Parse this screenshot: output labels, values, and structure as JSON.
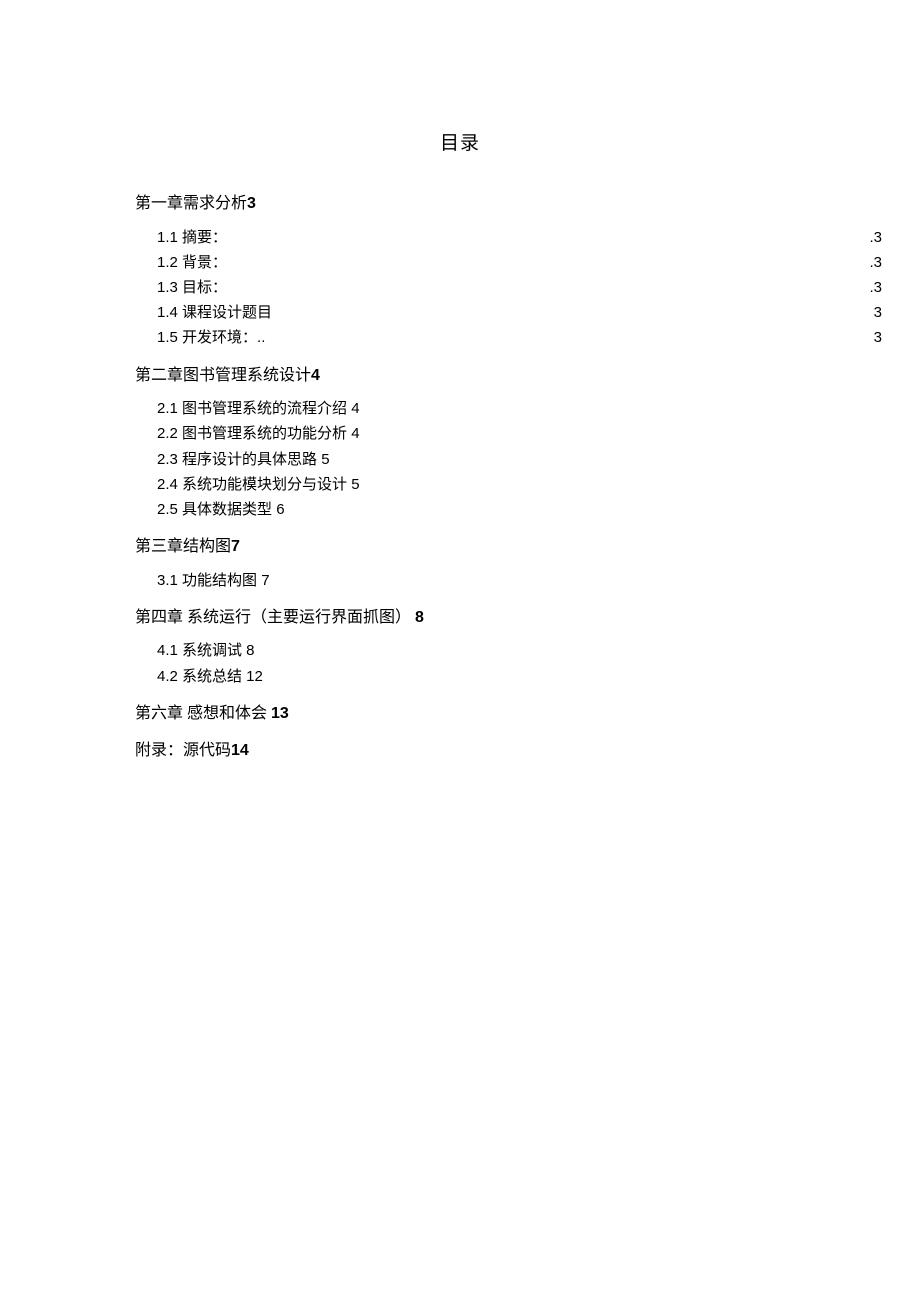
{
  "title": "目录",
  "toc": [
    {
      "heading": "第一章需求分析",
      "headingPage": "3",
      "items": [
        {
          "label": "1.1 摘要：",
          "page": ".3",
          "leader": true
        },
        {
          "label": "1.2 背景：",
          "page": ".3",
          "leader": true
        },
        {
          "label": "1.3 目标：",
          "page": ".3",
          "leader": true
        },
        {
          "label": "1.4 课程设计题目",
          "page": "3",
          "leader": true
        },
        {
          "label": "1.5 开发环境：..",
          "page": "3",
          "leader": true
        }
      ]
    },
    {
      "heading": "第二章图书管理系统设计",
      "headingPage": "4",
      "items": [
        {
          "label": "2.1 图书管理系统的流程介绍 4",
          "page": "",
          "leader": false
        },
        {
          "label": "2.2 图书管理系统的功能分析 4",
          "page": "",
          "leader": false
        },
        {
          "label": "2.3 程序设计的具体思路 5",
          "page": "",
          "leader": false
        },
        {
          "label": "2.4 系统功能模块划分与设计 5",
          "page": "",
          "leader": false
        },
        {
          "label": "2.5 具体数据类型 6",
          "page": "",
          "leader": false
        }
      ]
    },
    {
      "heading": "第三章结构图",
      "headingPage": "7",
      "items": [
        {
          "label": "3.1 功能结构图 7",
          "page": "",
          "leader": false
        }
      ]
    },
    {
      "heading": "第四章  系统运行（主要运行界面抓图） ",
      "headingPage": "8",
      "items": [
        {
          "label": "4.1 系统调试 8",
          "page": "",
          "leader": false
        },
        {
          "label": "4.2 系统总结 12",
          "page": "",
          "leader": false
        }
      ]
    },
    {
      "heading": "第六章  感想和体会 ",
      "headingPage": "13",
      "items": []
    },
    {
      "heading": "附录：源代码",
      "headingPage": "14",
      "items": []
    }
  ]
}
